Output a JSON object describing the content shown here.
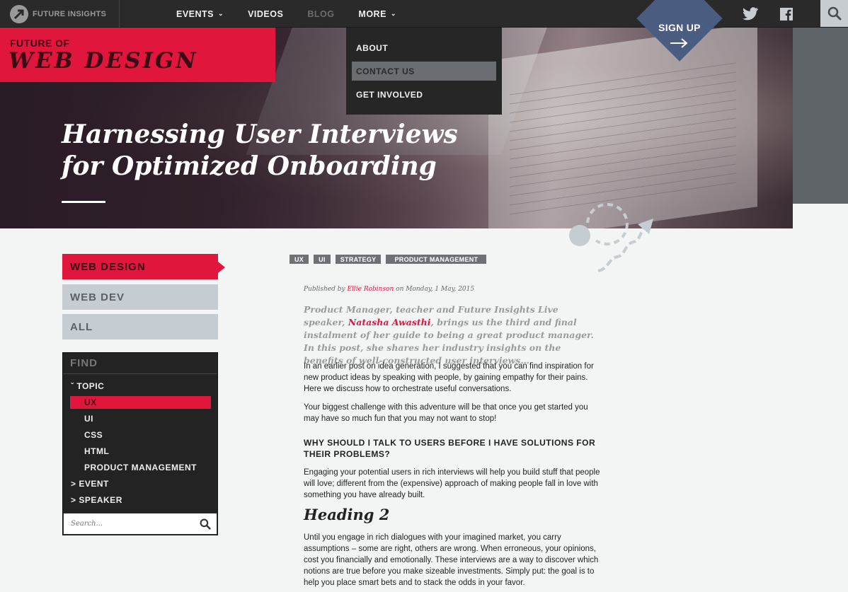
{
  "header": {
    "logo_text": "FUTURE INSIGHTS",
    "nav": [
      {
        "label": "EVENTS",
        "has_chevron": true
      },
      {
        "label": "VIDEOS",
        "has_chevron": false
      },
      {
        "label": "BLOG",
        "has_chevron": false
      },
      {
        "label": "MORE",
        "has_chevron": true
      }
    ],
    "icons": [
      "twitter-icon",
      "facebook-icon",
      "search-icon"
    ]
  },
  "dropdown": {
    "items": [
      {
        "label": "ABOUT",
        "active": false
      },
      {
        "label": "CONTACT US",
        "active": true
      },
      {
        "label": "GET INVOLVED",
        "active": false
      }
    ]
  },
  "signup": {
    "label": "SIGN UP"
  },
  "hero": {
    "badge_top": "FUTURE OF",
    "badge_main": "WEB DESIGN",
    "title_line1": "Harnessing User Interviews",
    "title_line2": "for Optimized Onboarding"
  },
  "sidebar": {
    "categories": [
      {
        "label": "WEB DESIGN",
        "active": true
      },
      {
        "label": "WEB DEV",
        "active": false
      },
      {
        "label": "ALL",
        "active": false
      }
    ],
    "find": {
      "title": "FIND",
      "topic_label": "ˇ TOPIC",
      "topics": [
        "UX",
        "UI",
        "CSS",
        "HTML",
        "PRODUCT MANAGEMENT"
      ],
      "event_label": "> EVENT",
      "speaker_label": "> SPEAKER",
      "search_placeholder": "Search..."
    }
  },
  "article": {
    "tags": [
      "UX",
      "UI",
      "STRATEGY",
      "PRODUCT MANAGEMENT"
    ],
    "meta_prefix": "Published by ",
    "author": "Ellie Robinson",
    "meta_suffix": " on Monday, 1 May, 2015",
    "intro_a": "Product Manager, teacher and Future Insights Live speaker, ",
    "intro_name": "Natasha Awasthi",
    "intro_b": ", brings us the third and final instalment of her guide to being a great product manager. In this post, she shares her industry insights on the benefits of well-constructed user interviews…",
    "p1": "In an earlier post on idea generation, I suggested that you can find inspiration for new product ideas by speaking with people, by gaining empathy for their pains. Here we discuss how to orchestrate useful conversations.",
    "p2": "Your biggest challenge with this adventure will be that once you get started you may have so much fun that you may not want to stop!",
    "h_question": "WHY SHOULD I TALK TO USERS BEFORE I HAVE SOLUTIONS FOR THEIR PROBLEMS?",
    "p3": "Engaging your potential users in rich interviews will help you build stuff that people will love; different from the (expensive) approach of making people fall in love with something you have already built.",
    "h2": "Heading 2",
    "p4": "Until you engage in rich dialogues with your imagined market, you carry assumptions – some are right, others are wrong. When erroneous, your opinions, cost you financially and emotionally. These interviews are a way to discover which notions are true before you make sizeable investments. Simply put: the goal is to help you place smart bets and to stack the odds in your favor."
  },
  "colors": {
    "accent": "#e0163c",
    "signup": "#4a5c80",
    "dark": "#232323",
    "tag": "#6d7174"
  }
}
